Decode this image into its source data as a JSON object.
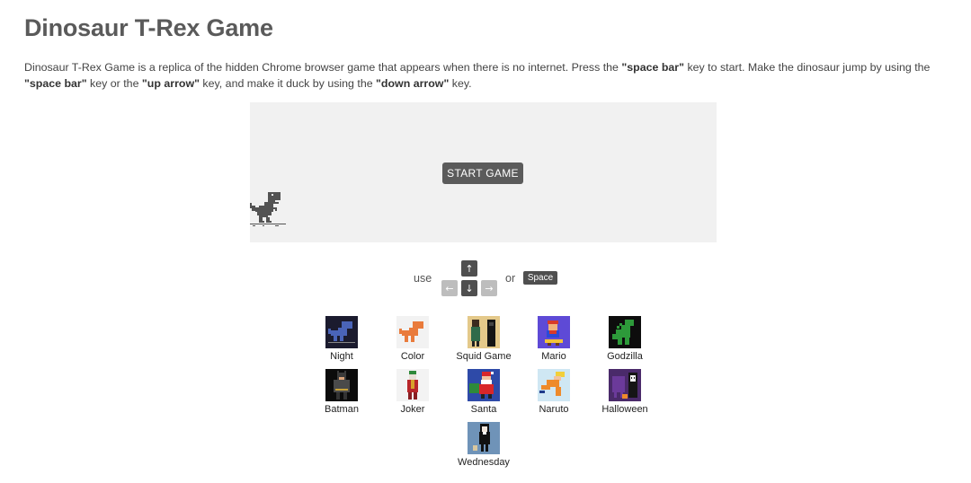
{
  "page": {
    "title": "Dinosaur T-Rex Game",
    "description": {
      "part1": "Dinosaur T-Rex Game is a replica of the hidden Chrome browser game that appears when there is no internet. Press the ",
      "b1": "\"space bar\"",
      "part2": " key to start. Make the dinosaur jump by using the ",
      "b2": "\"space bar\"",
      "part3": " key or the ",
      "b3": "\"up arrow\"",
      "part4": " key, and make it duck by using the ",
      "b4": "\"down arrow\"",
      "part5": " key."
    }
  },
  "game": {
    "start_label": "START GAME",
    "background_color": "#f1f1f1",
    "dino_color": "#535353"
  },
  "controls": {
    "use_label": "use",
    "or_label": "or",
    "up_key": "↑",
    "left_key": "←",
    "down_key": "↓",
    "right_key": "→",
    "space_key": "Space"
  },
  "skins": [
    {
      "label": "Night",
      "icon": "night-dino-icon"
    },
    {
      "label": "Color",
      "icon": "color-dino-icon"
    },
    {
      "label": "Squid Game",
      "icon": "squid-game-icon"
    },
    {
      "label": "Mario",
      "icon": "mario-icon"
    },
    {
      "label": "Godzilla",
      "icon": "godzilla-icon"
    },
    {
      "label": "Batman",
      "icon": "batman-icon"
    },
    {
      "label": "Joker",
      "icon": "joker-icon"
    },
    {
      "label": "Santa",
      "icon": "santa-icon"
    },
    {
      "label": "Naruto",
      "icon": "naruto-icon"
    },
    {
      "label": "Halloween",
      "icon": "halloween-icon"
    },
    {
      "label": "Wednesday",
      "icon": "wednesday-icon"
    }
  ]
}
